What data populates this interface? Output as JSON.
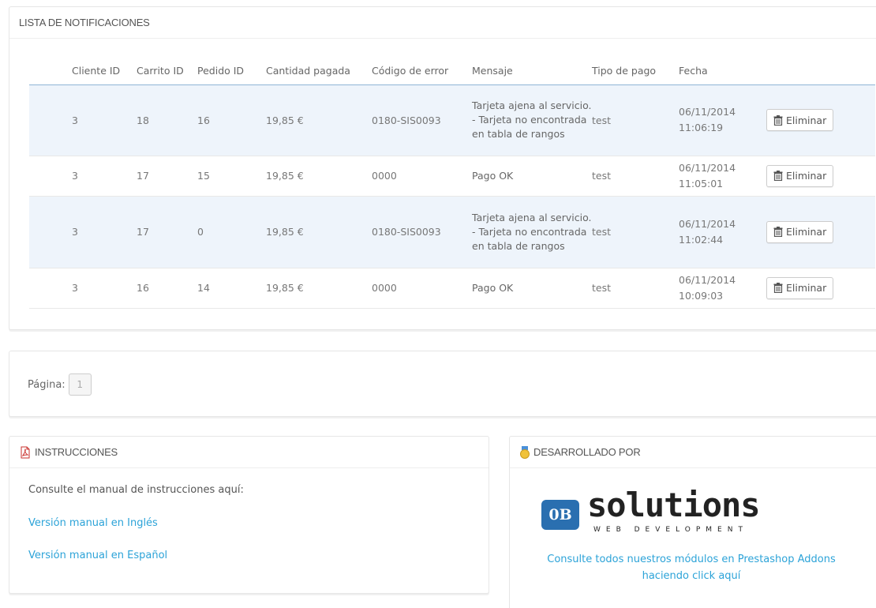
{
  "notifications": {
    "title": "LISTA DE NOTIFICACIONES",
    "columns": [
      "Cliente ID",
      "Carrito ID",
      "Pedido ID",
      "Cantidad pagada",
      "Código de error",
      "Mensaje",
      "Tipo de pago",
      "Fecha"
    ],
    "rows": [
      {
        "cliente": "3",
        "carrito": "18",
        "pedido": "16",
        "cantidad": "19,85 €",
        "codigo": "0180-SIS0093",
        "mensaje": "Tarjeta ajena al servicio. - Tarjeta no encontrada en tabla de rangos",
        "tipo": "test",
        "fecha": "06/11/2014",
        "hora": "11:06:19",
        "delete_label": "Eliminar"
      },
      {
        "cliente": "3",
        "carrito": "17",
        "pedido": "15",
        "cantidad": "19,85 €",
        "codigo": "0000",
        "mensaje": "Pago OK",
        "tipo": "test",
        "fecha": "06/11/2014",
        "hora": "11:05:01",
        "delete_label": "Eliminar"
      },
      {
        "cliente": "3",
        "carrito": "17",
        "pedido": "0",
        "cantidad": "19,85 €",
        "codigo": "0180-SIS0093",
        "mensaje": "Tarjeta ajena al servicio. - Tarjeta no encontrada en tabla de rangos",
        "tipo": "test",
        "fecha": "06/11/2014",
        "hora": "11:02:44",
        "delete_label": "Eliminar"
      },
      {
        "cliente": "3",
        "carrito": "16",
        "pedido": "14",
        "cantidad": "19,85 €",
        "codigo": "0000",
        "mensaje": "Pago OK",
        "tipo": "test",
        "fecha": "06/11/2014",
        "hora": "10:09:03",
        "delete_label": "Eliminar"
      }
    ]
  },
  "pagination": {
    "label": "Página:",
    "current": "1"
  },
  "instructions": {
    "title": "INSTRUCCIONES",
    "text": "Consulte el manual de instrucciones aquí:",
    "link_en": "Versión manual en Inglés",
    "link_es": "Versión manual en Español"
  },
  "developer": {
    "title": "DESARROLLADO POR",
    "logo_badge": "0B",
    "logo_word": "solutions",
    "logo_sub": "WEB DEVELOPMENT",
    "link_line1": "Consulte todos nuestros módulos en Prestashop Addons",
    "link_line2": "haciendo click aquí"
  },
  "colors": {
    "link": "#2ca3d8",
    "row_shade": "#eef4fb",
    "header_border": "#8fb4d6",
    "logo_badge": "#2a6fb0"
  }
}
